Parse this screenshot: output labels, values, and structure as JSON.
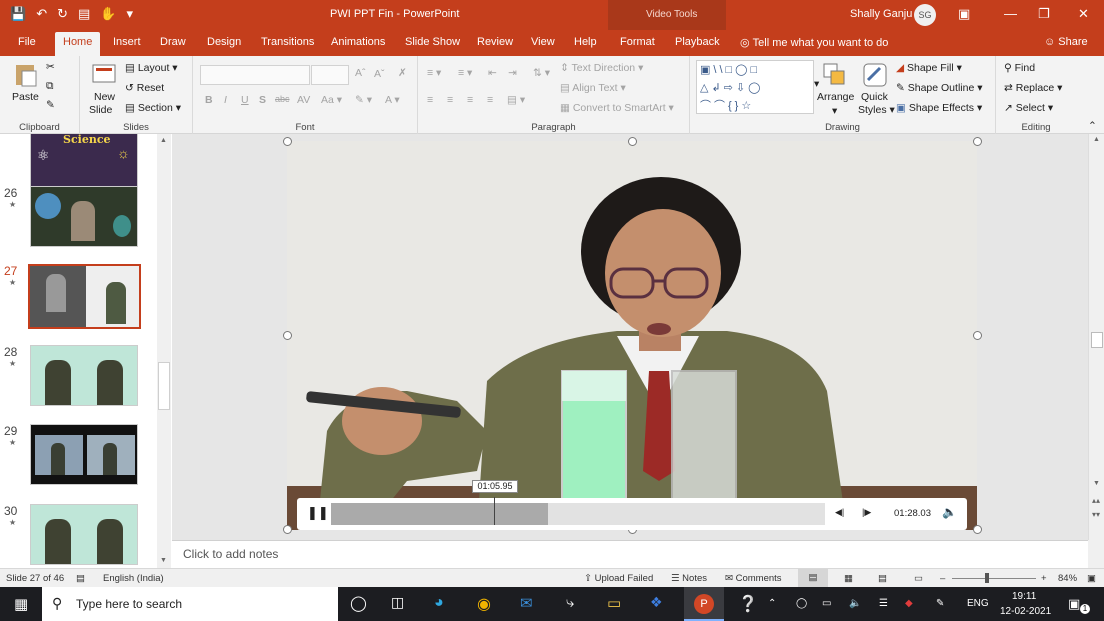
{
  "titlebar": {
    "doc_title": "PWI PPT Fin  -  PowerPoint",
    "context_tab": "Video Tools",
    "user_name": "Shally Ganju",
    "user_initials": "SG"
  },
  "tabs": [
    "File",
    "Home",
    "Insert",
    "Draw",
    "Design",
    "Transitions",
    "Animations",
    "Slide Show",
    "Review",
    "View",
    "Help",
    "Format",
    "Playback"
  ],
  "active_tab": "Home",
  "tell_me": "Tell me what you want to do",
  "share": "Share",
  "ribbon": {
    "clipboard": {
      "label": "Clipboard",
      "paste": "Paste"
    },
    "slides": {
      "label": "Slides",
      "new_slide_1": "New",
      "new_slide_2": "Slide",
      "layout": "Layout",
      "reset": "Reset",
      "section": "Section"
    },
    "font": {
      "label": "Font"
    },
    "paragraph": {
      "label": "Paragraph",
      "text_direction": "Text Direction",
      "align_text": "Align Text",
      "convert_smartart": "Convert to SmartArt"
    },
    "drawing": {
      "label": "Drawing",
      "arrange": "Arrange",
      "quick_styles_1": "Quick",
      "quick_styles_2": "Styles",
      "shape_fill": "Shape Fill",
      "shape_outline": "Shape Outline",
      "shape_effects": "Shape Effects"
    },
    "editing": {
      "label": "Editing",
      "find": "Find",
      "replace": "Replace",
      "select": "Select"
    }
  },
  "thumbnails": [
    {
      "num": "",
      "top_text": "Science",
      "active": false
    },
    {
      "num": "26",
      "active": false
    },
    {
      "num": "27",
      "active": true
    },
    {
      "num": "28",
      "active": false
    },
    {
      "num": "29",
      "active": false
    },
    {
      "num": "30",
      "active": false
    }
  ],
  "player": {
    "tooltip_time": "01:05.95",
    "duration": "01:28.03",
    "progress_fraction": 0.44,
    "cursor_fraction": 0.33
  },
  "notes_placeholder": "Click to add notes",
  "status": {
    "slide_info": "Slide 27 of 46",
    "language": "English (India)",
    "upload": "Upload Failed",
    "notes": "Notes",
    "comments": "Comments",
    "zoom": "84%"
  },
  "taskbar": {
    "search_placeholder": "Type here to search",
    "lang": "ENG",
    "time": "19:11",
    "date": "12-02-2021",
    "notif_count": "1"
  },
  "colors": {
    "accent": "#c43e1c",
    "ribbon_bg": "#f3f3f3",
    "taskbar_bg": "#1c1d21"
  }
}
